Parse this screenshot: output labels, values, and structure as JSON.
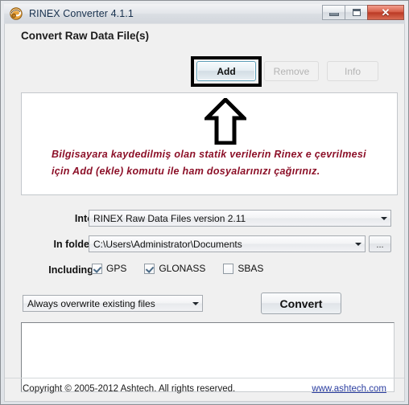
{
  "window": {
    "title": "RINEX Converter 4.1.1",
    "icon": "app-swirl-icon",
    "controls": {
      "minimize": "minimize-icon",
      "maximize": "maximize-icon",
      "close": "close-icon",
      "close_glyph": "✕"
    }
  },
  "toolbar": {
    "section_title": "Convert Raw Data File(s)",
    "add_label": "Add",
    "remove_label": "Remove",
    "info_label": "Info"
  },
  "annotation": {
    "arrow": "up-arrow-annotation",
    "text": "Bilgisayara kaydedilmiş olan statik verilerin Rinex e çevrilmesi için Add (ekle) komutu ile ham dosyalarınızı çağırınız.",
    "text_color": "#8c1028",
    "highlight_color": "#000000"
  },
  "form": {
    "into_label": "Into:",
    "into_value": "RINEX Raw Data Files version 2.11",
    "in_folder_label": "In folder:",
    "in_folder_value": "C:\\Users\\Administrator\\Documents",
    "browse_label": "...",
    "including_label": "Including:",
    "checkboxes": [
      {
        "label": "GPS",
        "checked": true
      },
      {
        "label": "GLONASS",
        "checked": true
      },
      {
        "label": "SBAS",
        "checked": false
      }
    ],
    "overwrite_value": "Always overwrite existing files",
    "convert_label": "Convert"
  },
  "log": {
    "content": ""
  },
  "footer": {
    "copyright": "Copyright © 2005-2012 Ashtech. All rights reserved.",
    "link": "www.ashtech.com",
    "link_color": "#2b3ea0"
  }
}
